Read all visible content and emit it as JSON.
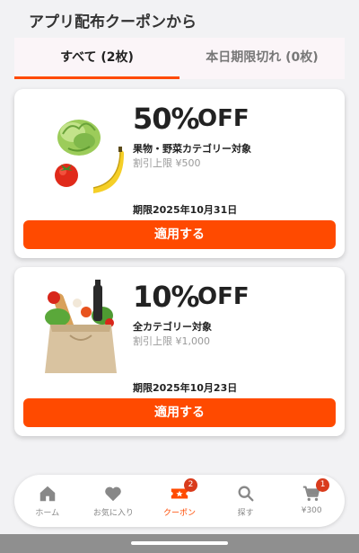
{
  "header": {
    "title": "アプリ配布クーポンから"
  },
  "tabs": [
    {
      "label": "すべて (2枚)",
      "active": true
    },
    {
      "label": "本日期限切れ (0枚)",
      "active": false
    }
  ],
  "coupons": [
    {
      "percent": "50%",
      "off": "OFF",
      "target": "果物・野菜カテゴリー対象",
      "limit": "割引上限 ¥500",
      "expiry": "期限2025年10月31日",
      "apply_label": "適用する",
      "image": "vegetables-fruits-image"
    },
    {
      "percent": "10%",
      "off": "OFF",
      "target": "全カテゴリー対象",
      "limit": "割引上限 ¥1,000",
      "expiry": "期限2025年10月23日",
      "apply_label": "適用する",
      "image": "grocery-bag-image"
    }
  ],
  "nav": [
    {
      "label": "ホーム",
      "icon": "home-icon",
      "active": false
    },
    {
      "label": "お気に入り",
      "icon": "heart-icon",
      "active": false
    },
    {
      "label": "クーポン",
      "icon": "coupon-icon",
      "active": true,
      "badge": "2"
    },
    {
      "label": "探す",
      "icon": "search-icon",
      "active": false
    },
    {
      "label": "¥300",
      "icon": "cart-icon",
      "active": false,
      "badge": "1"
    }
  ],
  "colors": {
    "accent": "#ff4a00",
    "badge": "#d93b1c",
    "background": "#f2f2f4"
  }
}
